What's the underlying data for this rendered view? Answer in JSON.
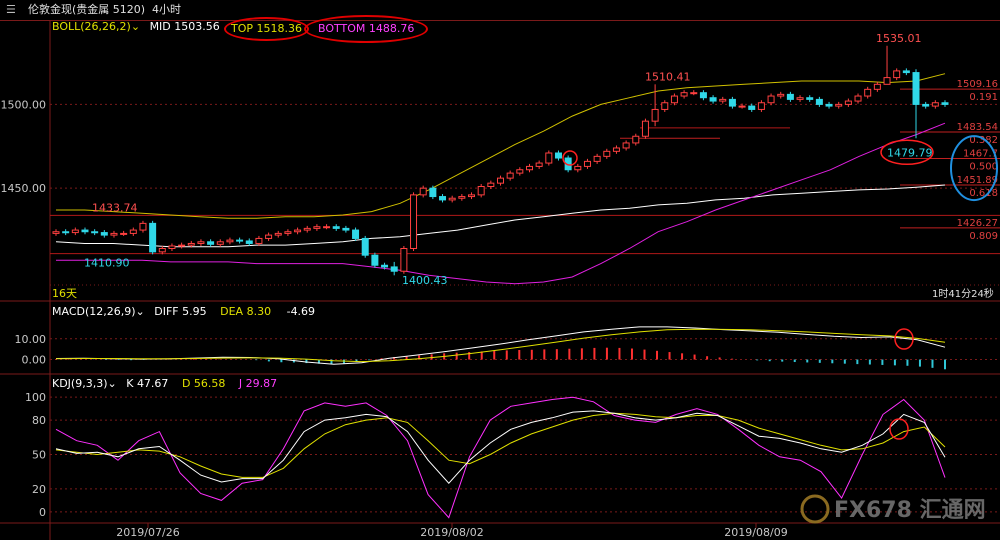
{
  "window": {
    "title": "伦敦金现(贵金属 5120)",
    "timeframe": "4小时",
    "menu_icon": "hamburger-menu-icon"
  },
  "boll": {
    "label": "BOLL(26,26,2)",
    "mid_label": "MID",
    "mid_value": "1503.56",
    "top_label": "TOP",
    "top_value": "1518.36",
    "bottom_label": "BOTTOM",
    "bottom_value": "1488.76",
    "colors": {
      "mid": "#ffffff",
      "top": "#d0c000",
      "bottom": "#e020e0"
    }
  },
  "macd": {
    "label": "MACD(12,26,9)",
    "diff_label": "DIFF",
    "diff_value": "5.95",
    "dea_label": "DEA",
    "dea_value": "8.30",
    "macd_value": "-4.69"
  },
  "kdj": {
    "label": "KDJ(9,3,3)",
    "k_label": "K",
    "k_value": "47.67",
    "d_label": "D",
    "d_value": "56.58",
    "j_label": "J",
    "j_value": "29.87"
  },
  "countdown": "1时41分24秒",
  "period_label": "16天",
  "watermark": "FX678 汇通网",
  "chart_data": {
    "type": "candlestick",
    "price_axis": {
      "ticks": [
        "1500.00",
        "1450.00"
      ],
      "ylim": [
        1394,
        1548
      ]
    },
    "macd_axis": {
      "ticks": [
        "10.00",
        "0.00"
      ],
      "ylim": [
        -6,
        20
      ]
    },
    "kdj_axis": {
      "ticks": [
        "100",
        "80",
        "50",
        "20",
        "0"
      ],
      "ylim": [
        -8,
        108
      ]
    },
    "x_labels": [
      "2019/07/26",
      "2019/08/02",
      "2019/08/09"
    ],
    "annotations": [
      "1433.74",
      "1410.90",
      "1400.43",
      "1510.41",
      "1535.01",
      "1479.79"
    ],
    "fib_levels": [
      {
        "price": "1509.16",
        "ratio": "0.191"
      },
      {
        "price": "1483.54",
        "ratio": "0.382"
      },
      {
        "price": "1467.7",
        "ratio": "0.500"
      },
      {
        "price": "1451.89",
        "ratio": "0.618"
      },
      {
        "price": "1426.27",
        "ratio": "0.809"
      }
    ],
    "closes": [
      1424,
      1423.5,
      1425,
      1424,
      1423.5,
      1422,
      1423,
      1423,
      1425,
      1429,
      1412,
      1414,
      1415.5,
      1416,
      1417,
      1418,
      1416.5,
      1418,
      1419,
      1418.5,
      1417,
      1420,
      1422,
      1423,
      1424,
      1425,
      1426,
      1427,
      1427,
      1426,
      1425,
      1420,
      1410,
      1404,
      1403,
      1400.43,
      1414,
      1446,
      1450,
      1445,
      1443,
      1444,
      1445,
      1446,
      1451,
      1453,
      1456,
      1459,
      1461,
      1463,
      1465,
      1471,
      1468,
      1461,
      1463,
      1466,
      1469,
      1472,
      1474,
      1477,
      1481,
      1490,
      1497,
      1501,
      1505,
      1507,
      1507,
      1504,
      1502,
      1503,
      1499,
      1499,
      1497,
      1501,
      1505,
      1506,
      1503,
      1504,
      1503,
      1500,
      1499,
      1500,
      1502,
      1505,
      1509,
      1512,
      1516,
      1520,
      1519,
      1500,
      1499,
      1501,
      1500
    ],
    "hl": [
      {
        "index": 35,
        "high": 1406,
        "low": 1398
      },
      {
        "index": 62,
        "high": 1512,
        "low": 1487
      },
      {
        "index": 86,
        "high": 1535.01,
        "low": 1512
      },
      {
        "index": 89,
        "high": 1521,
        "low": 1479.79
      }
    ],
    "boll_mid": [
      1418,
      1417,
      1417,
      1416,
      1415,
      1415,
      1415,
      1416,
      1416,
      1417,
      1418,
      1420,
      1421,
      1423,
      1425,
      1428,
      1431,
      1433,
      1435,
      1437,
      1438,
      1440,
      1441,
      1443,
      1444,
      1446,
      1447,
      1448,
      1449,
      1449.5,
      1450.5,
      1451.89
    ],
    "boll_top": [
      1437,
      1437,
      1436,
      1435,
      1434,
      1433,
      1432,
      1432,
      1433,
      1433,
      1434,
      1436,
      1441,
      1449,
      1458,
      1467,
      1476,
      1484,
      1493,
      1500,
      1504,
      1508,
      1510,
      1511,
      1512,
      1513,
      1514,
      1514,
      1514,
      1513,
      1514,
      1518.36
    ],
    "boll_bottom": [
      1407,
      1407,
      1407,
      1407,
      1406,
      1406,
      1406,
      1405,
      1405,
      1405,
      1405,
      1403,
      1401,
      1398,
      1396,
      1394,
      1393,
      1394,
      1397,
      1405,
      1414,
      1424,
      1430,
      1437,
      1443,
      1449,
      1455,
      1461,
      1469,
      1476,
      1482,
      1488.76
    ],
    "macd_diff": [
      0.5,
      0.6,
      0.4,
      0.2,
      0.3,
      0.7,
      1.1,
      1.0,
      0.4,
      -1.2,
      -2.3,
      -1.5,
      0.6,
      2.2,
      3.8,
      5.6,
      7.5,
      9.5,
      11.4,
      13.3,
      14.6,
      15.7,
      15.7,
      15.2,
      14.4,
      13.8,
      13.1,
      12.1,
      11.2,
      10.6,
      10.9,
      9.5,
      5.95
    ],
    "macd_dea": [
      0.4,
      0.5,
      0.5,
      0.4,
      0.4,
      0.5,
      0.7,
      0.8,
      0.7,
      0.2,
      -0.6,
      -1.0,
      -0.6,
      0.3,
      1.5,
      3.0,
      4.7,
      6.5,
      8.4,
      10.3,
      11.9,
      13.3,
      14.3,
      14.6,
      14.5,
      14.3,
      13.9,
      13.3,
      12.6,
      11.9,
      11.4,
      10.2,
      8.3
    ],
    "macd_hist": [
      0.2,
      0.2,
      0.1,
      -0.1,
      -0.2,
      -0.2,
      -0.3,
      -0.2,
      0.1,
      0.3,
      0.4,
      0.3,
      0.2,
      0.1,
      0.1,
      0.0,
      -0.3,
      -0.9,
      -1.3,
      -1.4,
      -1.7,
      -2.0,
      -2.1,
      -1.8,
      -1.2,
      -0.3,
      0.6,
      1.2,
      1.6,
      2.0,
      2.5,
      3.0,
      3.3,
      3.6,
      3.9,
      4.2,
      4.4,
      4.6,
      4.7,
      4.9,
      5.0,
      5.2,
      5.4,
      5.6,
      5.7,
      5.6,
      5.3,
      4.8,
      4.2,
      3.6,
      3.0,
      2.4,
      1.6,
      1.0,
      0.4,
      0.0,
      -0.4,
      -0.8,
      -1.0,
      -1.2,
      -1.4,
      -1.6,
      -1.8,
      -2.0,
      -2.2,
      -2.4,
      -2.6,
      -2.8,
      -3.0,
      -3.4,
      -4.0,
      -4.69
    ],
    "kdj_k": [
      55,
      51,
      52,
      48,
      55,
      57,
      45,
      32,
      26,
      29,
      29,
      45,
      70,
      80,
      82,
      85,
      83,
      70,
      45,
      25,
      45,
      60,
      72,
      78,
      82,
      87,
      88,
      86,
      82,
      80,
      82,
      86,
      84,
      75,
      66,
      64,
      60,
      55,
      52,
      58,
      68,
      85,
      78,
      47.67
    ],
    "kdj_d": [
      54,
      52,
      50,
      52,
      54,
      53,
      48,
      40,
      33,
      30,
      30,
      38,
      55,
      68,
      76,
      80,
      82,
      78,
      62,
      45,
      42,
      50,
      60,
      68,
      74,
      80,
      84,
      86,
      85,
      83,
      82,
      84,
      84,
      80,
      73,
      68,
      63,
      58,
      54,
      55,
      60,
      70,
      74,
      56.58
    ],
    "kdj_j": [
      72,
      62,
      58,
      45,
      62,
      70,
      34,
      16,
      10,
      25,
      28,
      55,
      88,
      95,
      92,
      95,
      84,
      62,
      15,
      -5,
      48,
      80,
      92,
      95,
      98,
      100,
      96,
      84,
      80,
      78,
      85,
      90,
      85,
      72,
      58,
      48,
      45,
      35,
      12,
      50,
      85,
      98,
      80,
      29.87
    ]
  }
}
